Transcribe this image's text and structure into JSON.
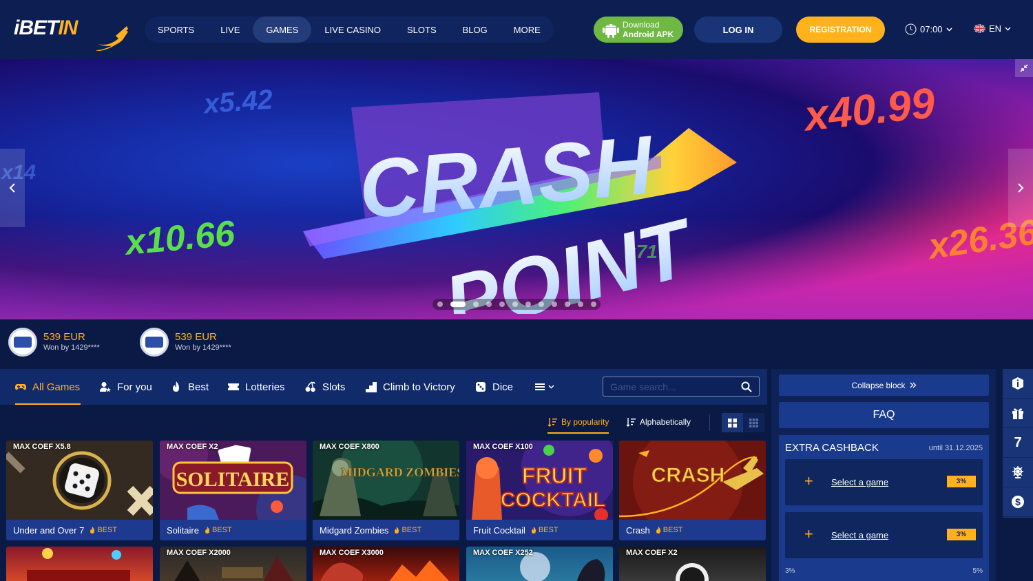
{
  "header": {
    "logo": {
      "main": "iBET",
      "accent": "IN"
    },
    "nav": [
      {
        "label": "SPORTS",
        "active": false
      },
      {
        "label": "LIVE",
        "active": false
      },
      {
        "label": "GAMES",
        "active": true
      },
      {
        "label": "LIVE CASINO",
        "active": false
      },
      {
        "label": "SLOTS",
        "active": false
      },
      {
        "label": "BLOG",
        "active": false
      },
      {
        "label": "MORE",
        "active": false
      }
    ],
    "apk": {
      "line1": "Download",
      "line2": "Android APK"
    },
    "login": "LOG IN",
    "register": "REGISTRATION",
    "time": "07:00",
    "language": "EN"
  },
  "banner": {
    "title_line1": "CRASH",
    "title_line2": "POINT",
    "coefs": [
      "x5.42",
      "x10.66",
      "x40.99",
      "x26.36",
      "x14",
      "x71"
    ],
    "slide_count": 12,
    "active_slide": 1
  },
  "winners": [
    {
      "amount": "539 EUR",
      "by": "Won by 1429****"
    },
    {
      "amount": "539 EUR",
      "by": "Won by 1429****"
    }
  ],
  "categories": [
    {
      "label": "All Games",
      "icon": "gamepad-icon",
      "active": true
    },
    {
      "label": "For you",
      "icon": "user-star-icon",
      "active": false
    },
    {
      "label": "Best",
      "icon": "fire-icon",
      "active": false
    },
    {
      "label": "Lotteries",
      "icon": "ticket-icon",
      "active": false
    },
    {
      "label": "Slots",
      "icon": "cherries-icon",
      "active": false
    },
    {
      "label": "Climb to Victory",
      "icon": "steps-icon",
      "active": false
    },
    {
      "label": "Dice",
      "icon": "dice-icon",
      "active": false
    }
  ],
  "search": {
    "placeholder": "Game search..."
  },
  "sort": {
    "popularity": "By popularity",
    "alpha": "Alphabetically"
  },
  "games": [
    {
      "coef": "MAX COEF X5.8",
      "name": "Under and Over 7",
      "badge": "BEST",
      "theme": "dice"
    },
    {
      "coef": "MAX COEF X2",
      "name": "Solitaire",
      "badge": "BEST",
      "theme": "solitaire"
    },
    {
      "coef": "MAX COEF X800",
      "name": "Midgard Zombies",
      "badge": "BEST",
      "theme": "midgard"
    },
    {
      "coef": "MAX COEF X100",
      "name": "Fruit Cocktail",
      "badge": "BEST",
      "theme": "fruit"
    },
    {
      "coef": "",
      "name": "Crash",
      "badge": "BEST",
      "theme": "crash"
    }
  ],
  "games_row2": [
    {
      "coef": ""
    },
    {
      "coef": "MAX COEF X2000"
    },
    {
      "coef": "MAX COEF X3000"
    },
    {
      "coef": "MAX COEF X252"
    },
    {
      "coef": "MAX COEF X2"
    }
  ],
  "thumb_titles": {
    "solitaire": "SOLITAIRE",
    "midgard": "MIDGARD ZOMBIES",
    "fruit1": "FRUIT",
    "fruit2": "COCKTAIL",
    "crash": "CRASH"
  },
  "panel": {
    "collapse": "Collapse block",
    "faq": "FAQ",
    "cashback_title": "EXTRA CASHBACK",
    "cashback_until": "until 31.12.2025",
    "slots": [
      {
        "label": "Select a game",
        "pct": "3%"
      },
      {
        "label": "Select a game",
        "pct": "3%"
      }
    ],
    "foot_left": "3%",
    "foot_right": "5%"
  },
  "side_icons": [
    "info-icon",
    "gift-icon",
    "seven-icon",
    "roulette-icon",
    "dollar-icon"
  ],
  "side_seven": "7",
  "colors": {
    "accent": "#ffb21c",
    "bg": "#0b1a45",
    "header": "#0d1f52",
    "apk": "#6fb843"
  }
}
